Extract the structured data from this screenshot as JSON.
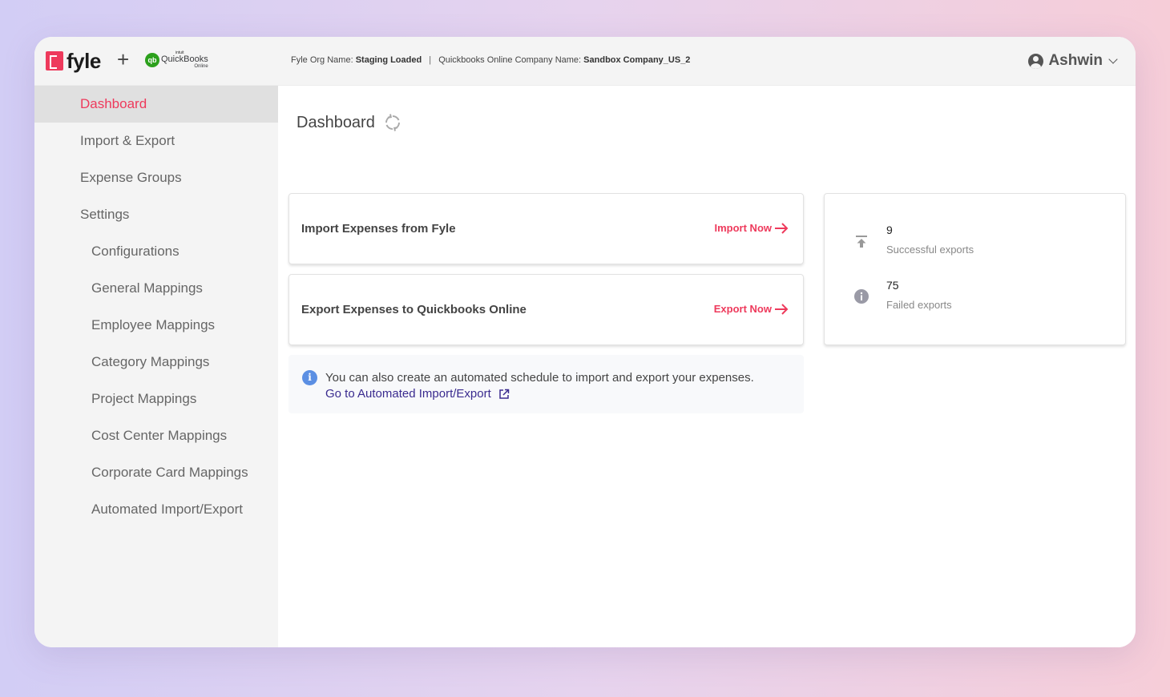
{
  "header": {
    "logo_text": "fyle",
    "plus": "+",
    "qb_logo": {
      "intuit": "intuit",
      "name": "QuickBooks",
      "sub": "Online",
      "mark": "qb"
    },
    "org_label": "Fyle Org Name:",
    "org_value": "Staging Loaded",
    "separator": "|",
    "company_label": "Quickbooks Online Company Name:",
    "company_value": "Sandbox Company_US_2",
    "user_name": "Ashwin",
    "user_icon": "user-circle-icon",
    "chevron_icon": "chevron-down-icon"
  },
  "sidebar": {
    "items": [
      {
        "label": "Dashboard",
        "active": true
      },
      {
        "label": "Import & Export"
      },
      {
        "label": "Expense Groups"
      },
      {
        "label": "Settings"
      },
      {
        "label": "Configurations"
      },
      {
        "label": "General Mappings"
      },
      {
        "label": "Employee Mappings"
      },
      {
        "label": "Category Mappings"
      },
      {
        "label": "Project Mappings"
      },
      {
        "label": "Cost Center Mappings"
      },
      {
        "label": "Corporate Card Mappings"
      },
      {
        "label": "Automated Import/Export"
      }
    ]
  },
  "main": {
    "title": "Dashboard",
    "refresh_icon": "sync-icon",
    "import_card": {
      "label": "Import Expenses from Fyle",
      "action": "Import Now"
    },
    "export_card": {
      "label": "Export Expenses to Quickbooks Online",
      "action": "Export Now"
    },
    "info": {
      "text": "You can also create an automated schedule to import and export your expenses.",
      "link": "Go to Automated Import/Export"
    },
    "stats": {
      "successful": {
        "value": "9",
        "label": "Successful exports"
      },
      "failed": {
        "value": "75",
        "label": "Failed exports"
      }
    }
  },
  "colors": {
    "accent": "#ee3a5c",
    "link": "#3a2b8f",
    "info_icon": "#5b8fe3",
    "sidebar_bg": "#f4f4f4",
    "sidebar_active_bg": "#e0e0e0"
  }
}
